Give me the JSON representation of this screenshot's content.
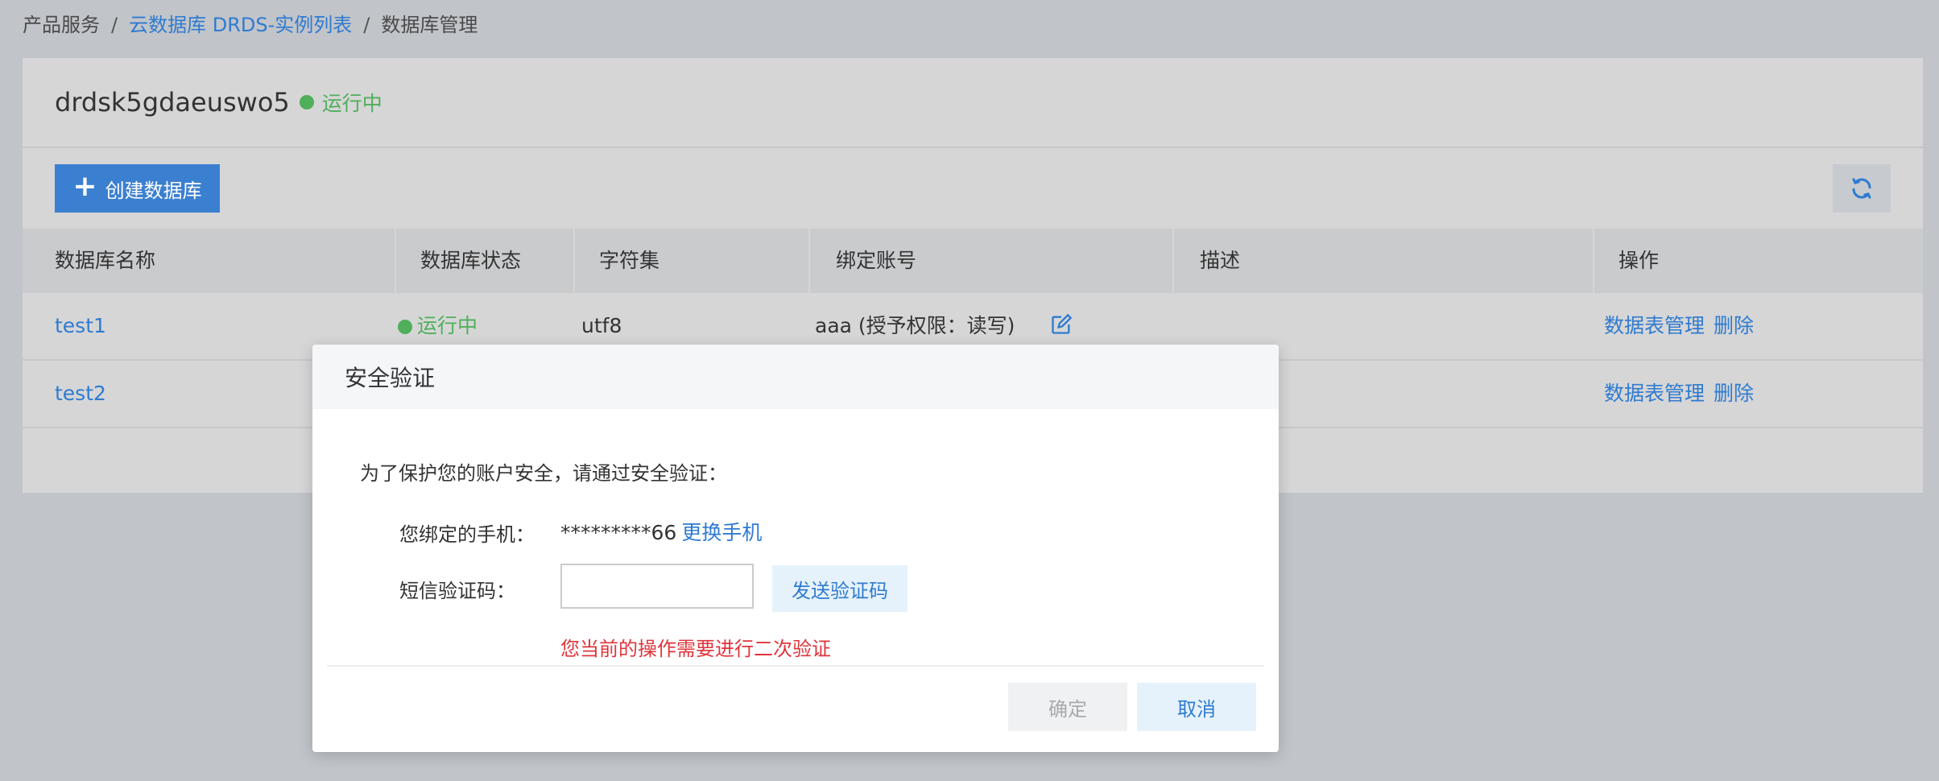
{
  "breadcrumb": {
    "items": [
      "产品服务",
      "云数据库 DRDS-实例列表",
      "数据库管理"
    ],
    "separator": "/"
  },
  "instance": {
    "name": "drdsk5gdaeuswo5",
    "status": "运行中",
    "status_color": "#4faf5a"
  },
  "toolbar": {
    "create_label": "创建数据库",
    "create_icon": "plus-icon",
    "refresh_icon": "refresh-icon"
  },
  "table": {
    "columns": [
      "数据库名称",
      "数据库状态",
      "字符集",
      "绑定账号",
      "描述",
      "操作"
    ],
    "rows": [
      {
        "name": "test1",
        "status": "运行中",
        "charset": "utf8",
        "account": "aaa (授予权限：读写)",
        "description": "",
        "actions": [
          "数据表管理",
          "删除"
        ]
      },
      {
        "name": "test2",
        "status": "",
        "charset": "",
        "account": "",
        "description": "",
        "actions": [
          "数据表管理",
          "删除"
        ]
      }
    ]
  },
  "modal": {
    "title": "安全验证",
    "intro": "为了保护您的账户安全，请通过安全验证：",
    "phone_label": "您绑定的手机：",
    "phone_value": "*********66",
    "change_phone": "更换手机",
    "sms_label": "短信验证码：",
    "sms_value": "",
    "send_code": "发送验证码",
    "error": "您当前的操作需要进行二次验证",
    "ok": "确定",
    "cancel": "取消"
  },
  "colors": {
    "accent": "#2f7bd0",
    "primary_button": "#3b7fd1",
    "success": "#4faf5a",
    "error": "#e0343b"
  }
}
